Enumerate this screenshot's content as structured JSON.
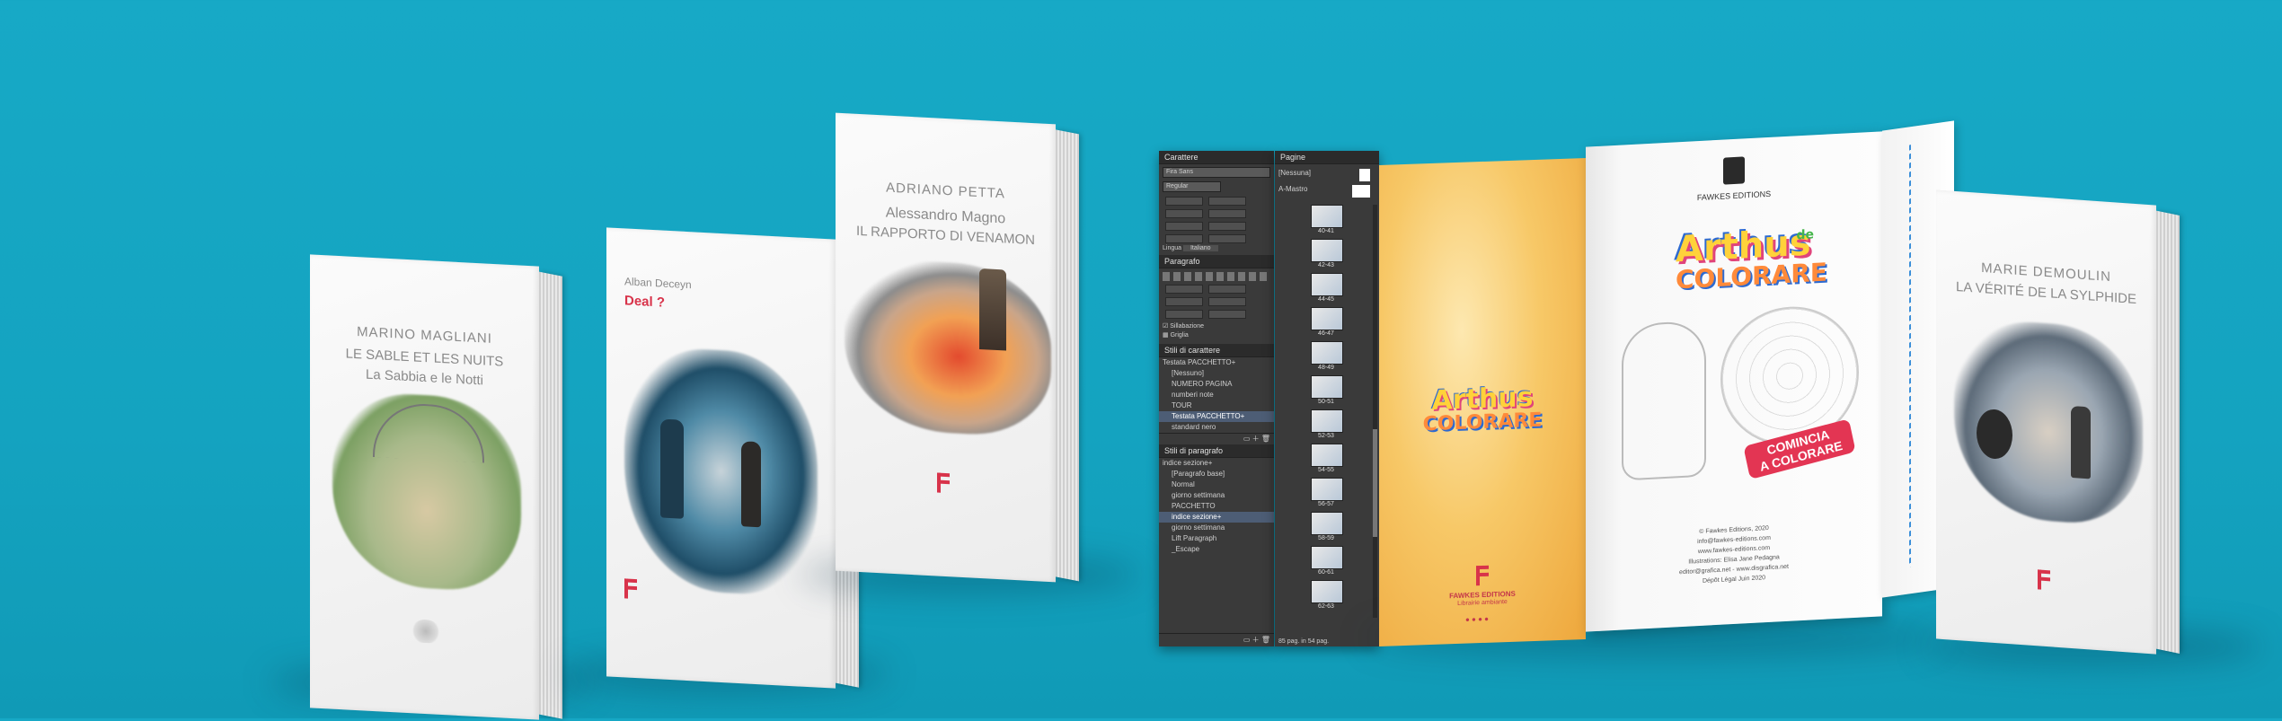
{
  "books": [
    {
      "id": "magliani",
      "author": "MARINO MAGLIANI",
      "title_line1": "LE SABLE ET LES NUITS",
      "subtitle": "La Sabbia e le Notti"
    },
    {
      "id": "deceyn",
      "author": "Alban Deceyn",
      "title_line1": "Deal ?",
      "subtitle": ""
    },
    {
      "id": "petta",
      "author": "ADRIANO PETTA",
      "title_line1": "Alessandro Magno",
      "title_line2": "IL RAPPORTO DI VENAMON"
    },
    {
      "id": "demoulin",
      "author": "MARIE DEMOULIN",
      "title_line1": "LA VÉRITÉ DE LA SYLPHIDE"
    }
  ],
  "indesign": {
    "character_panel": {
      "title": "Carattere",
      "font": "Fira Sans",
      "style": "Regular",
      "language": "Italiano",
      "language_label": "Lingua"
    },
    "paragraph_panel": {
      "title": "Paragrafo",
      "hyphenate_label": "Sillabazione",
      "grid_label": "Griglia"
    },
    "char_styles": {
      "title": "Stili di carattere",
      "current": "Testata PACCHETTO+",
      "items": [
        "[Nessuno]",
        "NUMERO PAGINA",
        "numberi note",
        "TOUR",
        "Testata PACCHETTO+",
        "standard nero"
      ],
      "selected_index": 4
    },
    "para_styles": {
      "title": "Stili di paragrafo",
      "current": "indice sezione+",
      "items": [
        "[Paragrafo base]",
        "Normal",
        "giorno settimana",
        "PACCHETTO",
        "indice sezione+",
        "giorno settimana",
        "Lift Paragraph",
        "_Escape"
      ],
      "selected_index": 4
    },
    "pages_panel": {
      "title": "Pagine",
      "none_label": "[Nessuna]",
      "master_label": "A-Mastro",
      "pages": [
        "40-41",
        "42-43",
        "44-45",
        "46-47",
        "48-49",
        "50-51",
        "52-53",
        "54-55",
        "56-57",
        "58-59",
        "60-61",
        "62-63"
      ],
      "status": "85 pag. in 54 pag."
    }
  },
  "coloring_book": {
    "brand": "FAWKES EDITIONS",
    "logo_line1": "Arthus",
    "logo_line2": "COLORARE",
    "logo_small": "de",
    "cta_line1": "COMINCIA",
    "cta_line2": "A COLORARE",
    "imprint": [
      "© Fawkes Editions, 2020",
      "info@fawkes-editions.com",
      "www.fawkes-editions.com",
      "Illustrations: Elisa Jane Pedagna",
      "editor@grafica.net - www.disgrafica.net",
      "Dépôt Légal Juin 2020"
    ],
    "left_footer_brand": "FAWKES EDITIONS",
    "left_footer_sub": "Librairie ambiante"
  },
  "colors": {
    "background": "#15a5c2",
    "accent_red": "#d8334a",
    "panel_dark": "#3a3a3a"
  }
}
